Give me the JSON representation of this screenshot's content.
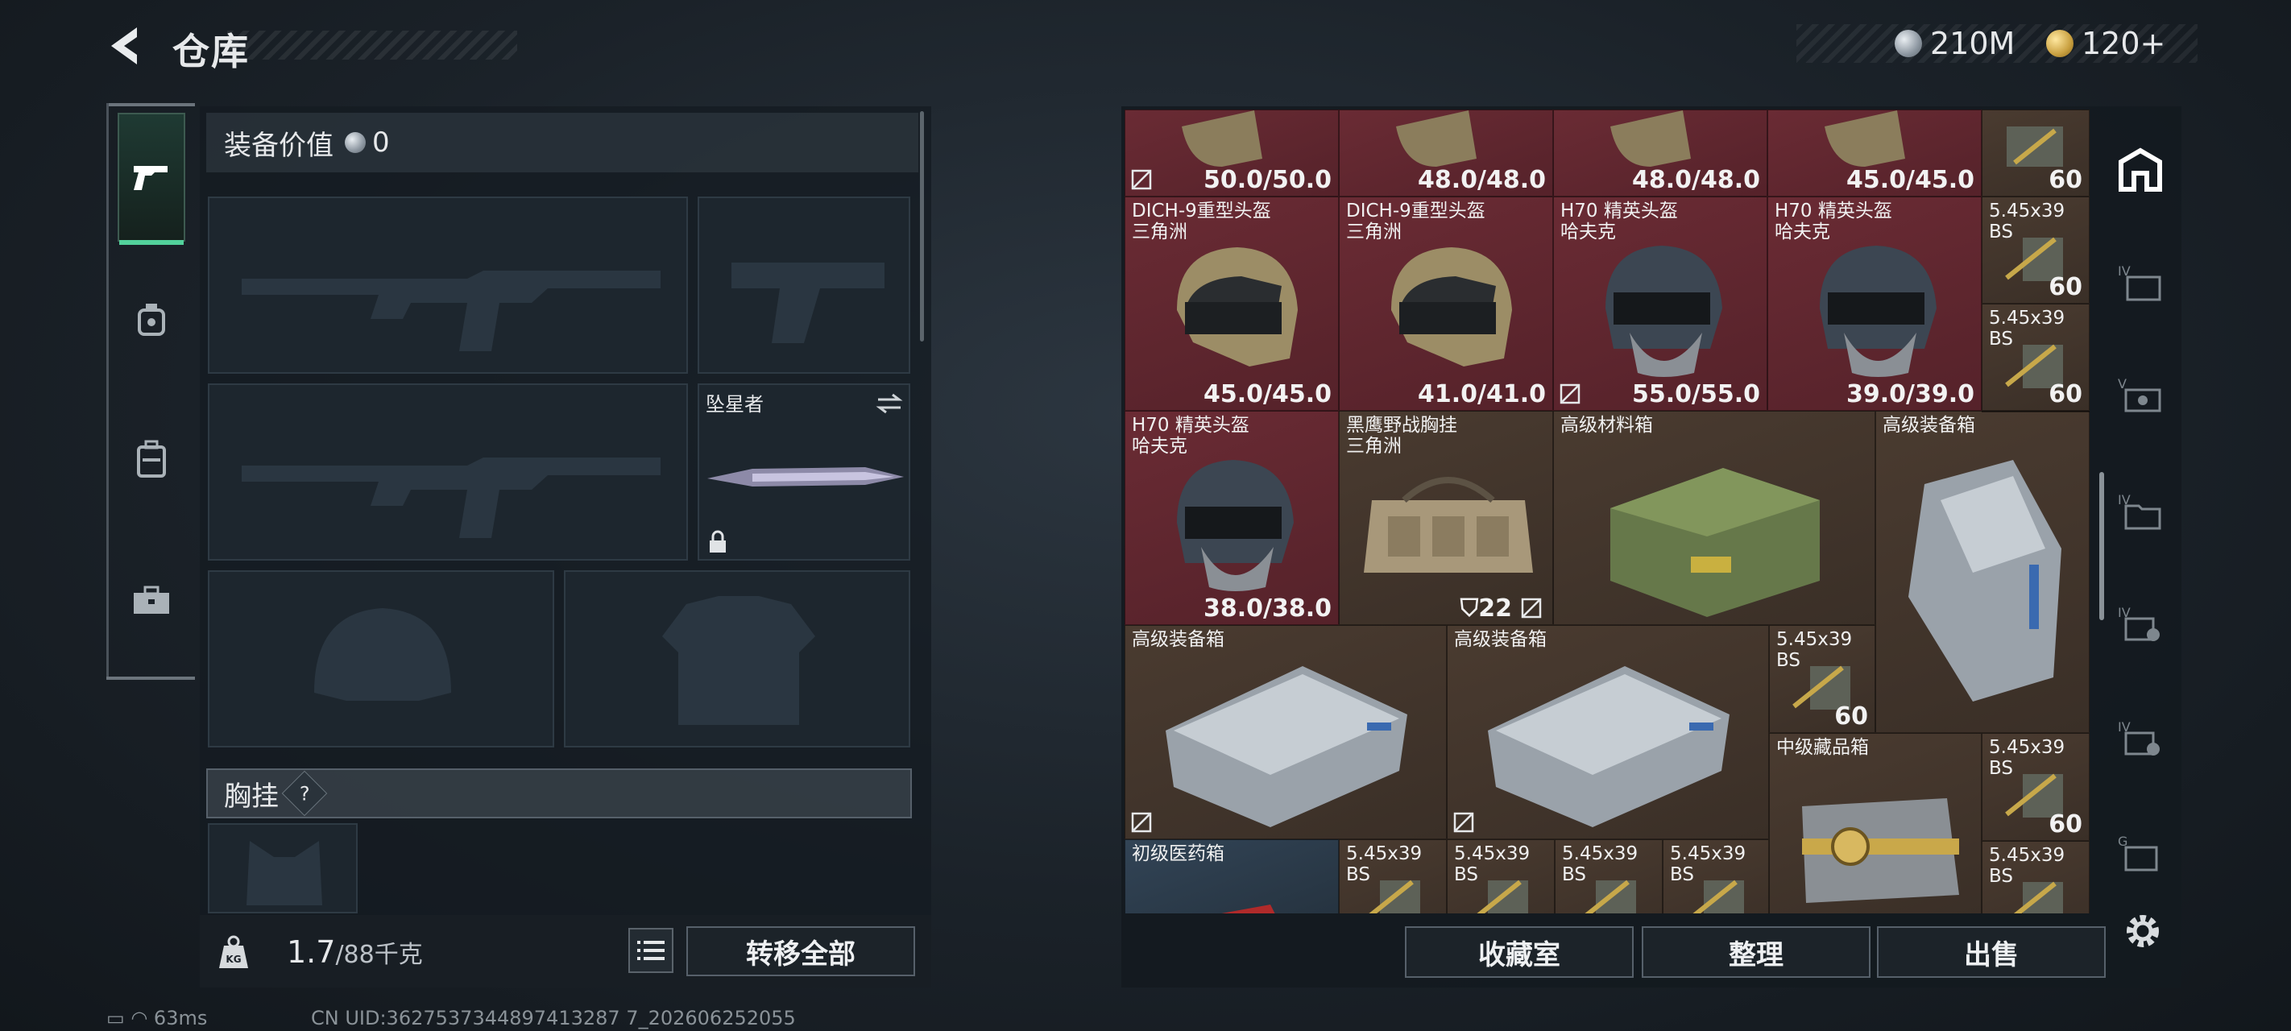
{
  "header": {
    "title": "仓库",
    "currency": [
      {
        "icon": "silver-coin-icon",
        "value": "210M"
      },
      {
        "icon": "gold-coin-icon",
        "value": "120+"
      }
    ]
  },
  "nav": {
    "items": [
      "gun-icon",
      "grenade-icon",
      "backpack-icon",
      "toolbox-icon"
    ],
    "active": 0
  },
  "equipment": {
    "value_label": "装备价值",
    "value": "0",
    "secondary_weapon": {
      "name": "坠星者",
      "locked": true
    },
    "rig_label": "胸挂",
    "help": "?",
    "weight": "1.7",
    "weight_max": "/88千克",
    "transfer_all": "转移全部"
  },
  "inventory": {
    "row1": [
      {
        "value": "50.0/50.0"
      },
      {
        "value": "48.0/48.0"
      },
      {
        "value": "48.0/48.0"
      },
      {
        "value": "45.0/45.0"
      },
      {
        "value": "60"
      }
    ],
    "helmets": [
      {
        "name": "DICH-9重型头盔\n三角洲",
        "value": "45.0/45.0"
      },
      {
        "name": "DICH-9重型头盔\n三角洲",
        "value": "41.0/41.0"
      },
      {
        "name": "H70 精英头盔\n哈夫克",
        "value": "55.0/55.0"
      },
      {
        "name": "H70 精英头盔\n哈夫克",
        "value": "39.0/39.0"
      },
      {
        "name": "H70 精英头盔\n哈夫克",
        "value": "38.0/38.0"
      }
    ],
    "ammo": {
      "name": "5.45x39\nBS",
      "count": "60"
    },
    "vest": {
      "name": "黑鹰野战胸挂\n三角洲",
      "value": "22"
    },
    "material_box": {
      "name": "高级材料箱"
    },
    "equip_box": {
      "name": "高级装备箱"
    },
    "collect_box": {
      "name": "中级藏品箱"
    },
    "med_box": {
      "name": "初级医药箱"
    }
  },
  "actions": {
    "collection": "收藏室",
    "sort": "整理",
    "sell": "出售"
  },
  "status": {
    "ping": "63ms",
    "uid": "CN UID:3627537344897413287 7_202606252055"
  },
  "colors": {
    "accent": "#52d19b",
    "rare_red": "#6a2b34",
    "rare_brown": "#4a3b30",
    "rare_blue": "#324456"
  }
}
